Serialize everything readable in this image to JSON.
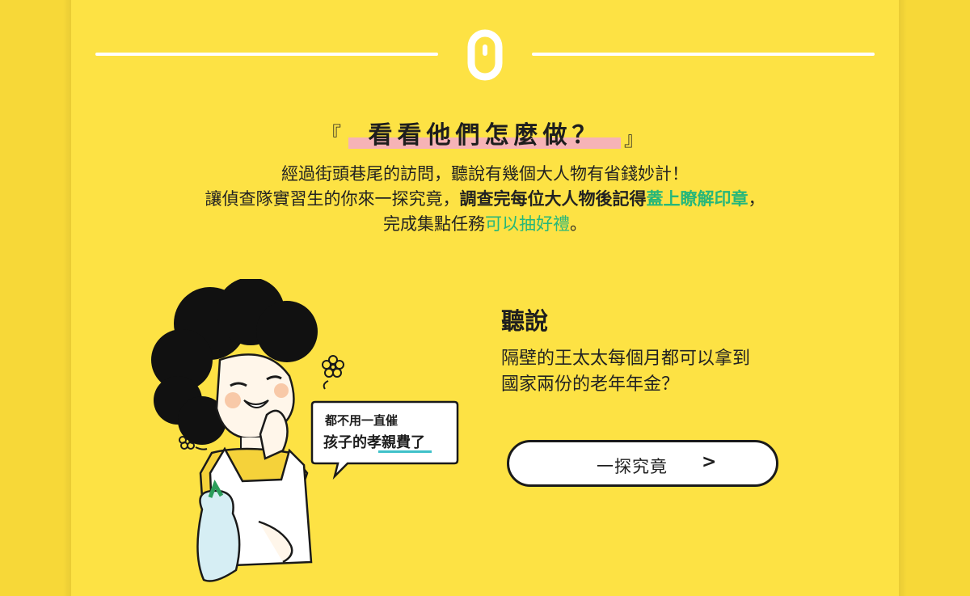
{
  "section": {
    "number_glyph": "0",
    "bracket_left": "『",
    "bracket_right": "』",
    "title": "看看他們怎麼做？"
  },
  "intro": {
    "line1": "經過街頭巷尾的訪問，聽說有幾個大人物有省錢妙計！",
    "line2_pre": "讓偵查隊實習生的你來一探究竟，",
    "line2_bold": "調查完每位大人物後記得",
    "line2_green": "蓋上瞭解印章",
    "line2_post": "，",
    "line3_pre": "完成集點任務",
    "line3_green": "可以抽好禮",
    "line3_post": "。"
  },
  "speech_bubble": {
    "line1": "都不用一直催",
    "line2": "孩子的孝親費了"
  },
  "hearsay": {
    "title": "聽說",
    "line1": "隔壁的王太太每個月都可以拿到",
    "line2": "國家兩份的老年年金？"
  },
  "cta": {
    "label": "一探究竟",
    "arrow": ">"
  },
  "colors": {
    "background": "#f7d838",
    "panel": "#fde244",
    "highlight": "#f6b3b6",
    "accent_green": "#26b77a",
    "underline_teal": "#3fc1c9"
  }
}
